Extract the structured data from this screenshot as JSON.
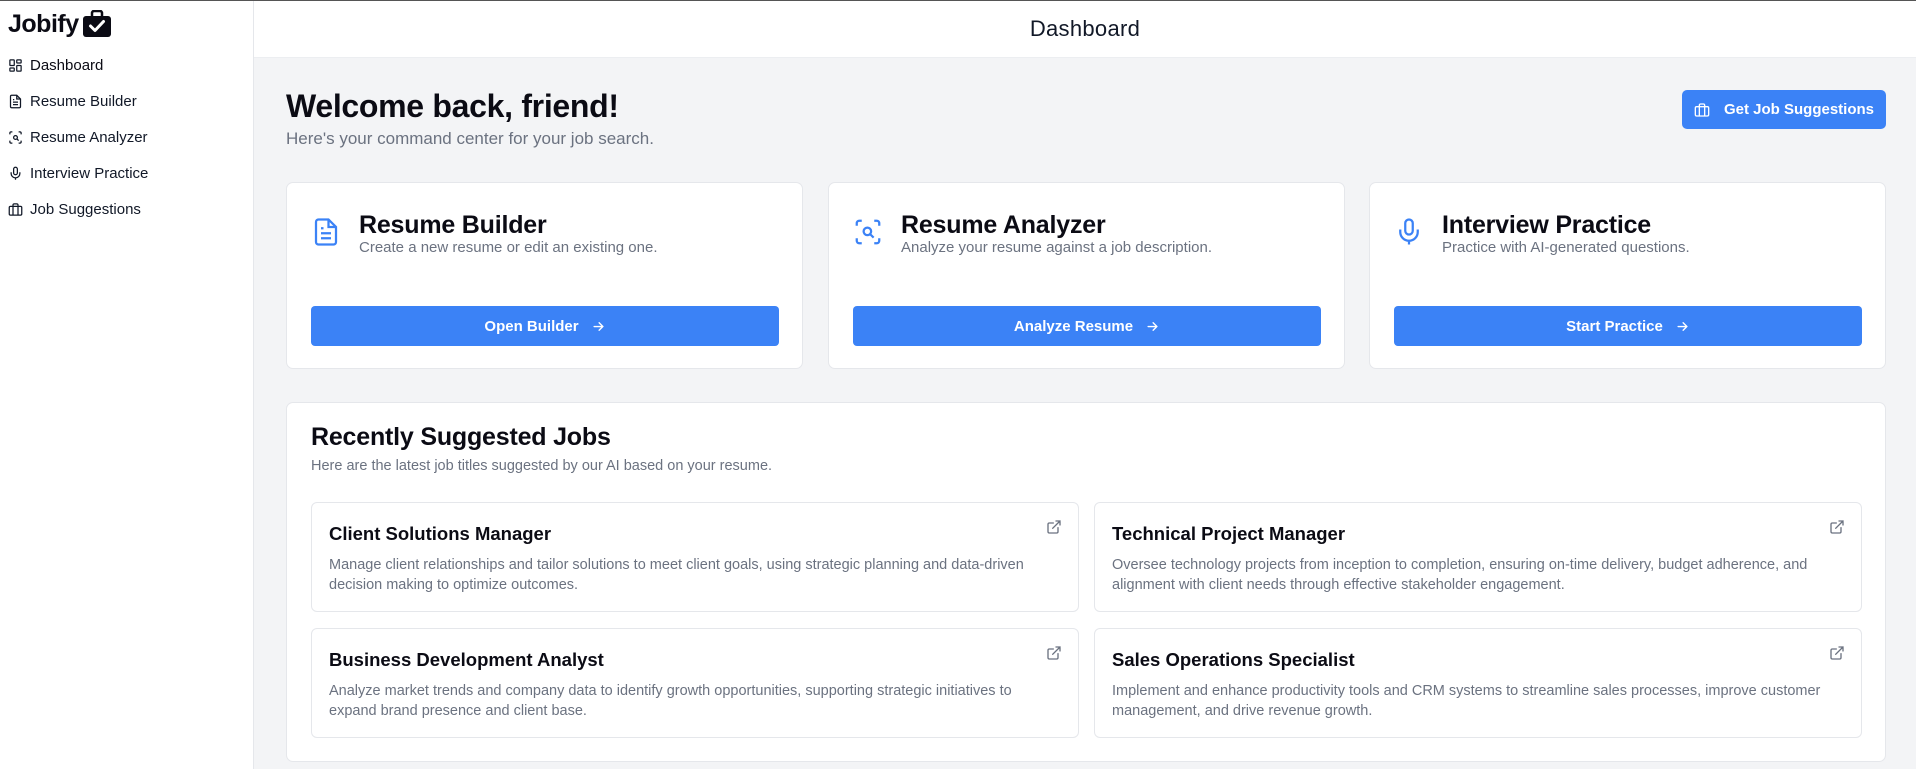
{
  "app": {
    "brand": "Jobify"
  },
  "sidebar": {
    "items": [
      {
        "label": "Dashboard",
        "icon": "layout-grid-icon"
      },
      {
        "label": "Resume Builder",
        "icon": "file-text-icon"
      },
      {
        "label": "Resume Analyzer",
        "icon": "scan-search-icon"
      },
      {
        "label": "Interview Practice",
        "icon": "microphone-icon"
      },
      {
        "label": "Job Suggestions",
        "icon": "briefcase-icon"
      }
    ]
  },
  "header": {
    "title": "Dashboard"
  },
  "welcome": {
    "title": "Welcome back, friend!",
    "subtitle": "Here's your command center for your job search.",
    "suggest_button": "Get Job Suggestions"
  },
  "cards": [
    {
      "title": "Resume Builder",
      "description": "Create a new resume or edit an existing one.",
      "button": "Open Builder",
      "icon": "file-text-icon"
    },
    {
      "title": "Resume Analyzer",
      "description": "Analyze your resume against a job description.",
      "button": "Analyze Resume",
      "icon": "scan-search-icon"
    },
    {
      "title": "Interview Practice",
      "description": "Practice with AI-generated questions.",
      "button": "Start Practice",
      "icon": "microphone-icon"
    }
  ],
  "jobs": {
    "title": "Recently Suggested Jobs",
    "subtitle": "Here are the latest job titles suggested by our AI based on your resume.",
    "items": [
      {
        "title": "Client Solutions Manager",
        "description": "Manage client relationships and tailor solutions to meet client goals, using strategic planning and data-driven decision making to optimize outcomes."
      },
      {
        "title": "Technical Project Manager",
        "description": "Oversee technology projects from inception to completion, ensuring on-time delivery, budget adherence, and alignment with client needs through effective stakeholder engagement."
      },
      {
        "title": "Business Development Analyst",
        "description": "Analyze market trends and company data to identify growth opportunities, supporting strategic initiatives to expand brand presence and client base."
      },
      {
        "title": "Sales Operations Specialist",
        "description": "Implement and enhance productivity tools and CRM systems to streamline sales processes, improve customer management, and drive revenue growth."
      }
    ]
  },
  "colors": {
    "accent": "#3b82f6",
    "muted_text": "#6b7280",
    "background": "#f3f4f6"
  }
}
